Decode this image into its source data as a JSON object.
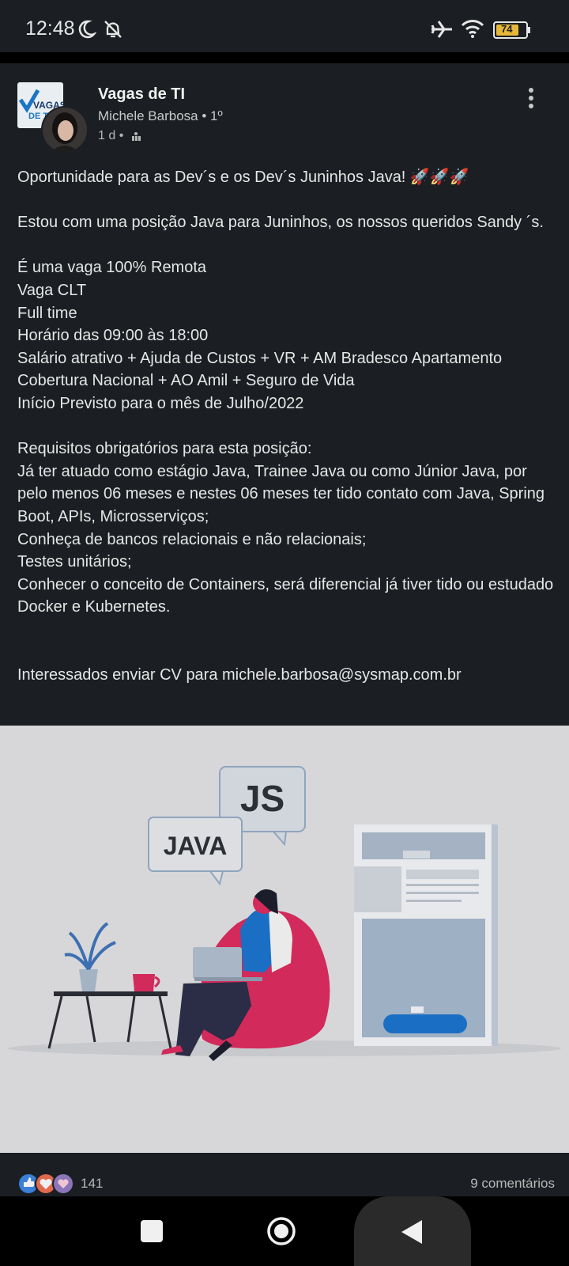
{
  "status_bar": {
    "time": "12:48",
    "battery": "74",
    "icons": [
      "moon-icon",
      "bell-off-icon",
      "airplane-icon",
      "wifi-icon",
      "battery-icon"
    ]
  },
  "post": {
    "group_name": "Vagas de TI",
    "logo_text_top": "VAGAS",
    "logo_text_bottom": "DE TI",
    "author": "Michele Barbosa • 1º",
    "time": "1 d •",
    "lines_1": [
      "Oportunidade para as Dev´s e os Dev´s Juninhos Java! 🚀🚀🚀"
    ],
    "lines_2": [
      "Estou com uma posição Java para Juninhos, os nossos queridos Sandy ´s."
    ],
    "lines_3": [
      "É uma vaga 100% Remota",
      "Vaga CLT",
      "Full time",
      "Horário das 09:00 às 18:00",
      "Salário atrativo + Ajuda de Custos + VR + AM Bradesco Apartamento Cobertura Nacional + AO Amil + Seguro de Vida",
      "Início Previsto para o mês de Julho/2022"
    ],
    "lines_4": [
      "Requisitos obrigatórios para esta posição:",
      "Já ter atuado como estágio Java, Trainee Java ou como Júnior Java, por pelo menos 06 meses e nestes 06 meses ter tido contato com Java, Spring Boot, APIs, Microsserviços;",
      "Conheça de bancos relacionais e não relacionais;",
      "Testes unitários;",
      "Conhecer o conceito de Containers, será diferencial já tiver tido ou estudado Docker e Kubernetes."
    ],
    "contact": "Interessados enviar CV para michele.barbosa@sysmap.com.br",
    "illustration": {
      "bubble_java": "JAVA",
      "bubble_js": "JS"
    },
    "reactions_count": "141",
    "comments": "9 comentários"
  },
  "nav": {
    "buttons": [
      "recents-button",
      "home-button",
      "back-button"
    ]
  },
  "colors": {
    "background": "#1b1f23",
    "illustration_bg": "#d7d7d9",
    "accent_blue": "#0a66c2",
    "beanbag": "#d22a5a"
  }
}
